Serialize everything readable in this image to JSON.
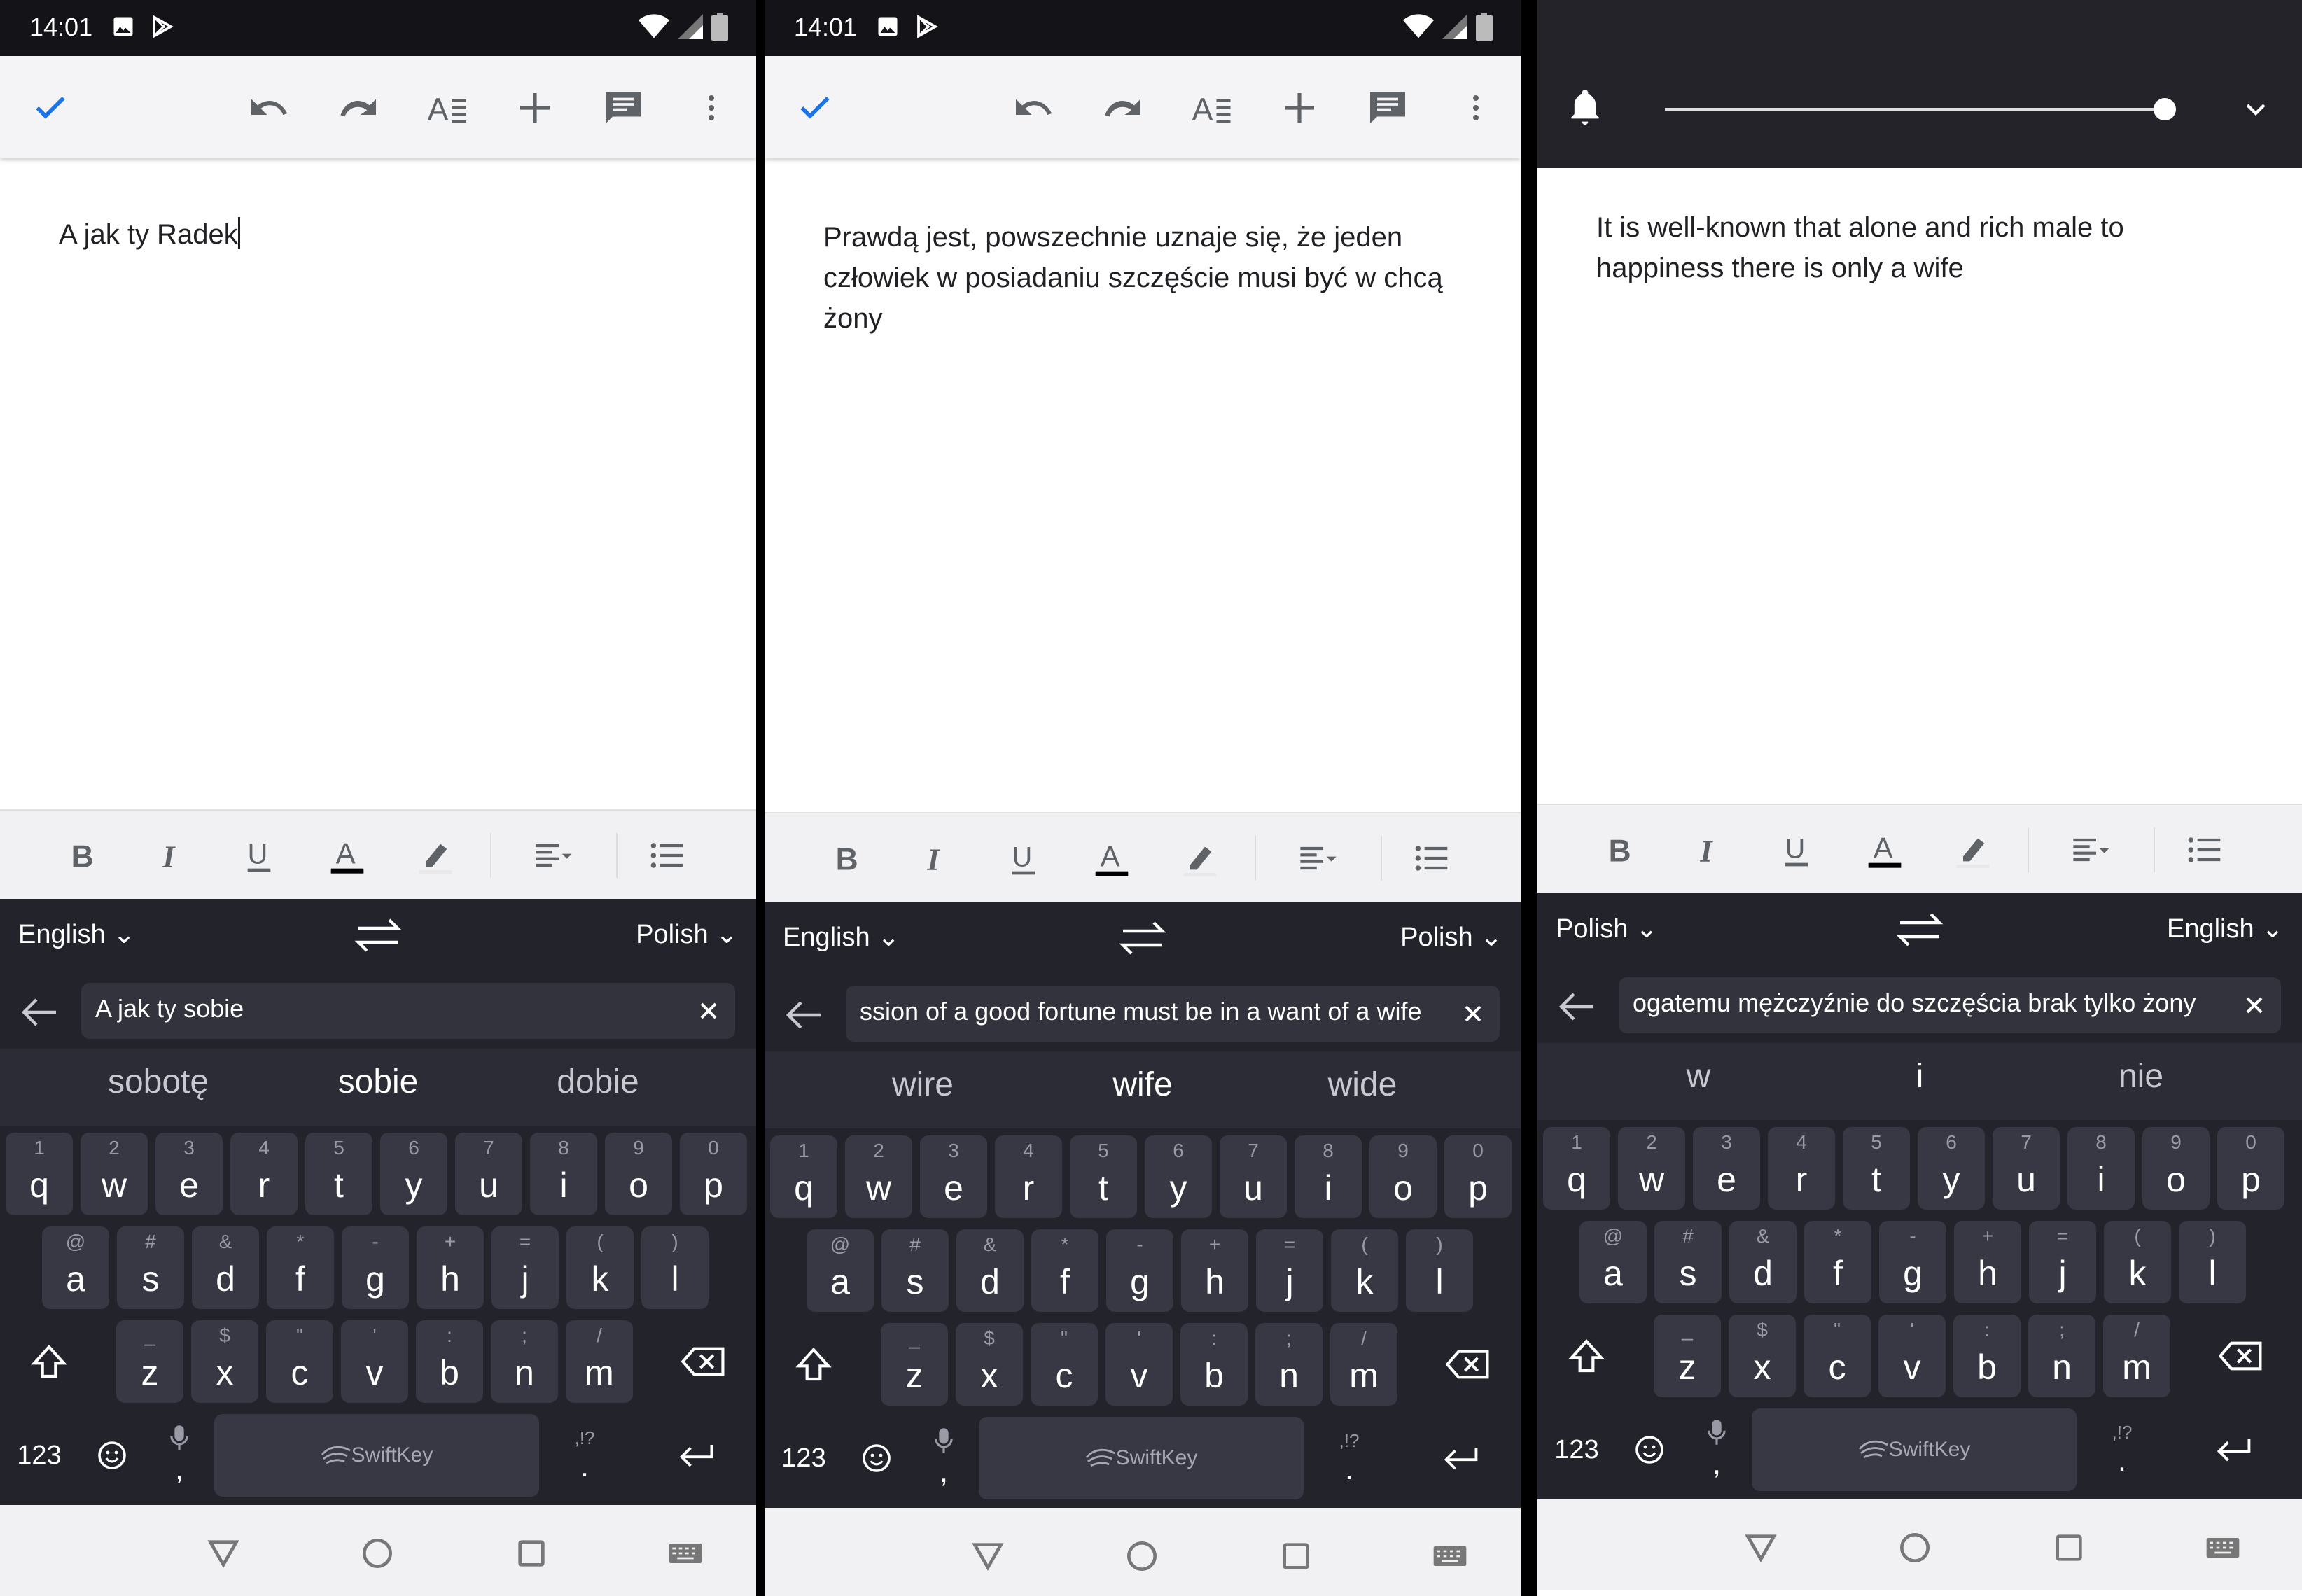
{
  "colors": {
    "accent": "#1a73e8",
    "status_bar": "#141418",
    "keyboard_bg": "#23232c",
    "key_bg": "#383844",
    "suggestion_bg": "#2c2c36",
    "toolbar_bg": "#f4f4f6"
  },
  "panels": [
    {
      "status_time": "14:01",
      "doc_text": "A jak ty Radek",
      "lang_from": "English ⌄",
      "lang_to": "Polish ⌄",
      "translator_text": "A jak ty sobie",
      "suggestions": [
        "sobotę",
        "sobie",
        "dobie"
      ]
    },
    {
      "status_time": "14:01",
      "doc_text": "Prawdą jest, powszechnie uznaje się, że jeden człowiek w posiadaniu szczęście musi być w chcą żony",
      "lang_from": "English ⌄",
      "lang_to": "Polish ⌄",
      "translator_text": "ssion of a good fortune must be in a want of a wife",
      "suggestions": [
        "wire",
        "wife",
        "wide"
      ]
    },
    {
      "doc_text": "It is well-known that alone and rich male to happiness there is only a wife",
      "lang_from": "Polish ⌄",
      "lang_to": "English ⌄",
      "translator_text": "ogatemu mężczyźnie do szczęścia brak tylko żony",
      "suggestions": [
        "w",
        "i",
        "nie"
      ],
      "volume_level": 1.0
    }
  ],
  "keyboard": {
    "row1": [
      {
        "k": "q",
        "h": "1"
      },
      {
        "k": "w",
        "h": "2"
      },
      {
        "k": "e",
        "h": "3"
      },
      {
        "k": "r",
        "h": "4"
      },
      {
        "k": "t",
        "h": "5"
      },
      {
        "k": "y",
        "h": "6"
      },
      {
        "k": "u",
        "h": "7"
      },
      {
        "k": "i",
        "h": "8"
      },
      {
        "k": "o",
        "h": "9"
      },
      {
        "k": "p",
        "h": "0"
      }
    ],
    "row2": [
      {
        "k": "a",
        "h": "@"
      },
      {
        "k": "s",
        "h": "#"
      },
      {
        "k": "d",
        "h": "&"
      },
      {
        "k": "f",
        "h": "*"
      },
      {
        "k": "g",
        "h": "-"
      },
      {
        "k": "h",
        "h": "+"
      },
      {
        "k": "j",
        "h": "="
      },
      {
        "k": "k",
        "h": "("
      },
      {
        "k": "l",
        "h": ")"
      }
    ],
    "row3": [
      {
        "k": "z",
        "h": "_"
      },
      {
        "k": "x",
        "h": "$"
      },
      {
        "k": "c",
        "h": "\""
      },
      {
        "k": "v",
        "h": "'"
      },
      {
        "k": "b",
        "h": ":"
      },
      {
        "k": "n",
        "h": ";"
      },
      {
        "k": "m",
        "h": "/"
      }
    ],
    "num_label": "123",
    "space_label": "SwiftKey",
    "comma_label": ",",
    "period_label": ".",
    "punct_hint": ",!?"
  }
}
